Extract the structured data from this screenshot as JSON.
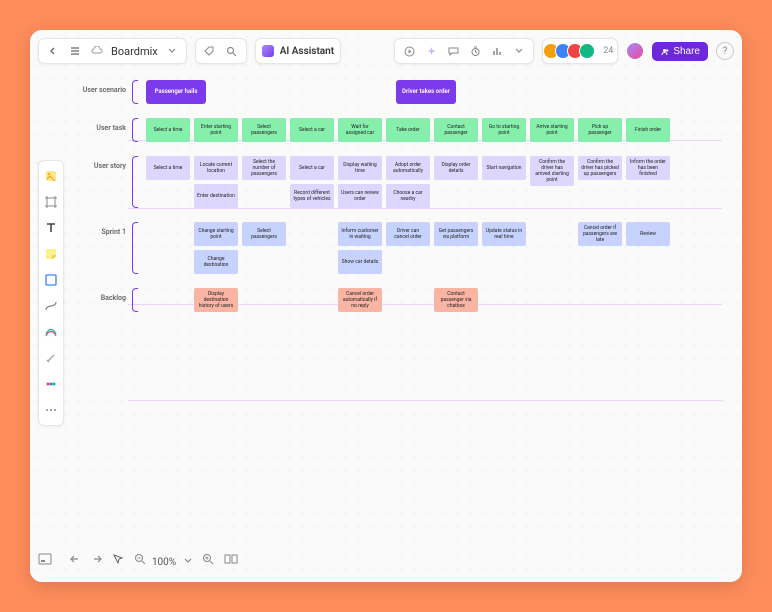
{
  "header": {
    "doc_name": "Boardmix",
    "ai_label": "AI Assistant",
    "avatar_count": "24",
    "share_label": "Share"
  },
  "bottom": {
    "zoom": "100%"
  },
  "rows": {
    "scenario_label": "User scenario",
    "task_label": "User task",
    "story_label": "User story",
    "sprint_label": "Sprint 1",
    "backlog_label": "Backlog"
  },
  "scenarios": [
    "Passenger hails",
    "Driver takes order"
  ],
  "tasks": [
    "Select a time",
    "Enter starting point",
    "Select passengers",
    "Select a car",
    "Wait for assigned car",
    "Take order",
    "Contact passenger",
    "Go to starting point",
    "Arrive starting point",
    "Pick up passenger",
    "Finish order"
  ],
  "stories": [
    [
      "Select a time"
    ],
    [
      "Locate current location",
      "Enter destination"
    ],
    [
      "Select the number of passengers"
    ],
    [
      "Select a car",
      "Record different types of vehicles"
    ],
    [
      "Display waiting time",
      "Users can review order"
    ],
    [
      "Adopt order automatically",
      "Choose a car nearby"
    ],
    [
      "Display order details"
    ],
    [
      "Start navigation"
    ],
    [
      "Confirm the driver has arrived starting point"
    ],
    [
      "Confirm the driver has picked up passengers"
    ],
    [
      "Inform the order has been finished"
    ]
  ],
  "sprint": [
    [],
    [
      "Change starting point",
      "Change destination"
    ],
    [
      "Select passengers"
    ],
    [],
    [
      "Inform customer in waiting",
      "Show car details"
    ],
    [
      "Driver can cancel order"
    ],
    [
      "Get passengers via platform"
    ],
    [
      "Update status in real time"
    ],
    [],
    [
      "Cancel order if passengers are late"
    ],
    [
      "Review"
    ]
  ],
  "backlog": [
    [],
    [
      "Display destination history of users"
    ],
    [],
    [],
    [
      "Cancel order automatically if no reply"
    ],
    [],
    [
      "Contact passenger via chatbox"
    ],
    [],
    [],
    [],
    []
  ]
}
